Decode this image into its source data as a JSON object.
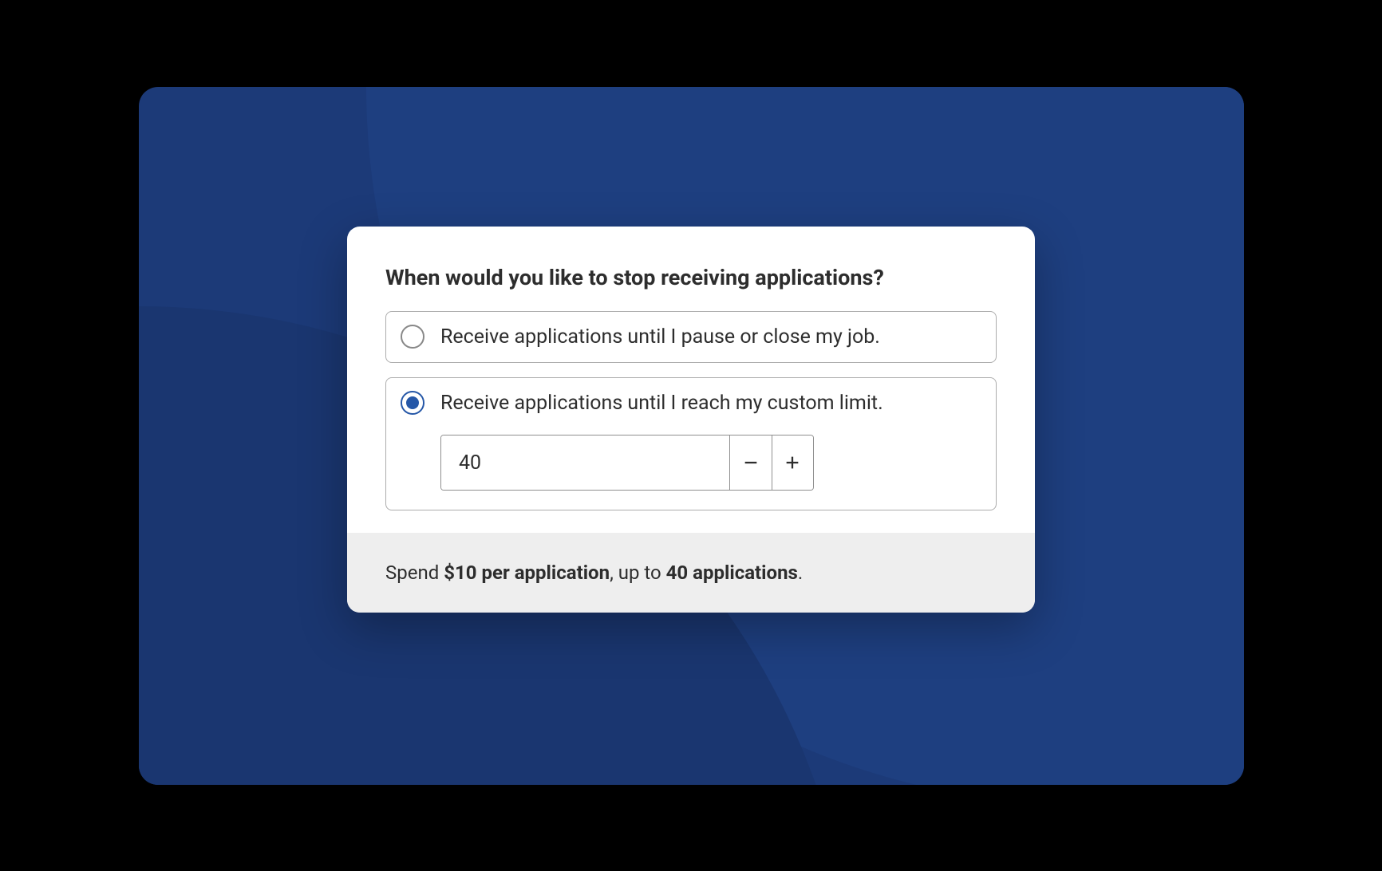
{
  "heading": "When would you like to stop receiving applications?",
  "options": {
    "pause_close": {
      "label": "Receive applications until I pause or close my job.",
      "selected": false
    },
    "custom_limit": {
      "label": "Receive applications until I reach my custom limit.",
      "selected": true,
      "value": "40"
    }
  },
  "summary": {
    "prefix": "Spend ",
    "price": "$10 per application",
    "mid": ", up to ",
    "limit": "40 applications",
    "suffix": "."
  },
  "icons": {
    "minus": "minus",
    "plus": "plus"
  }
}
